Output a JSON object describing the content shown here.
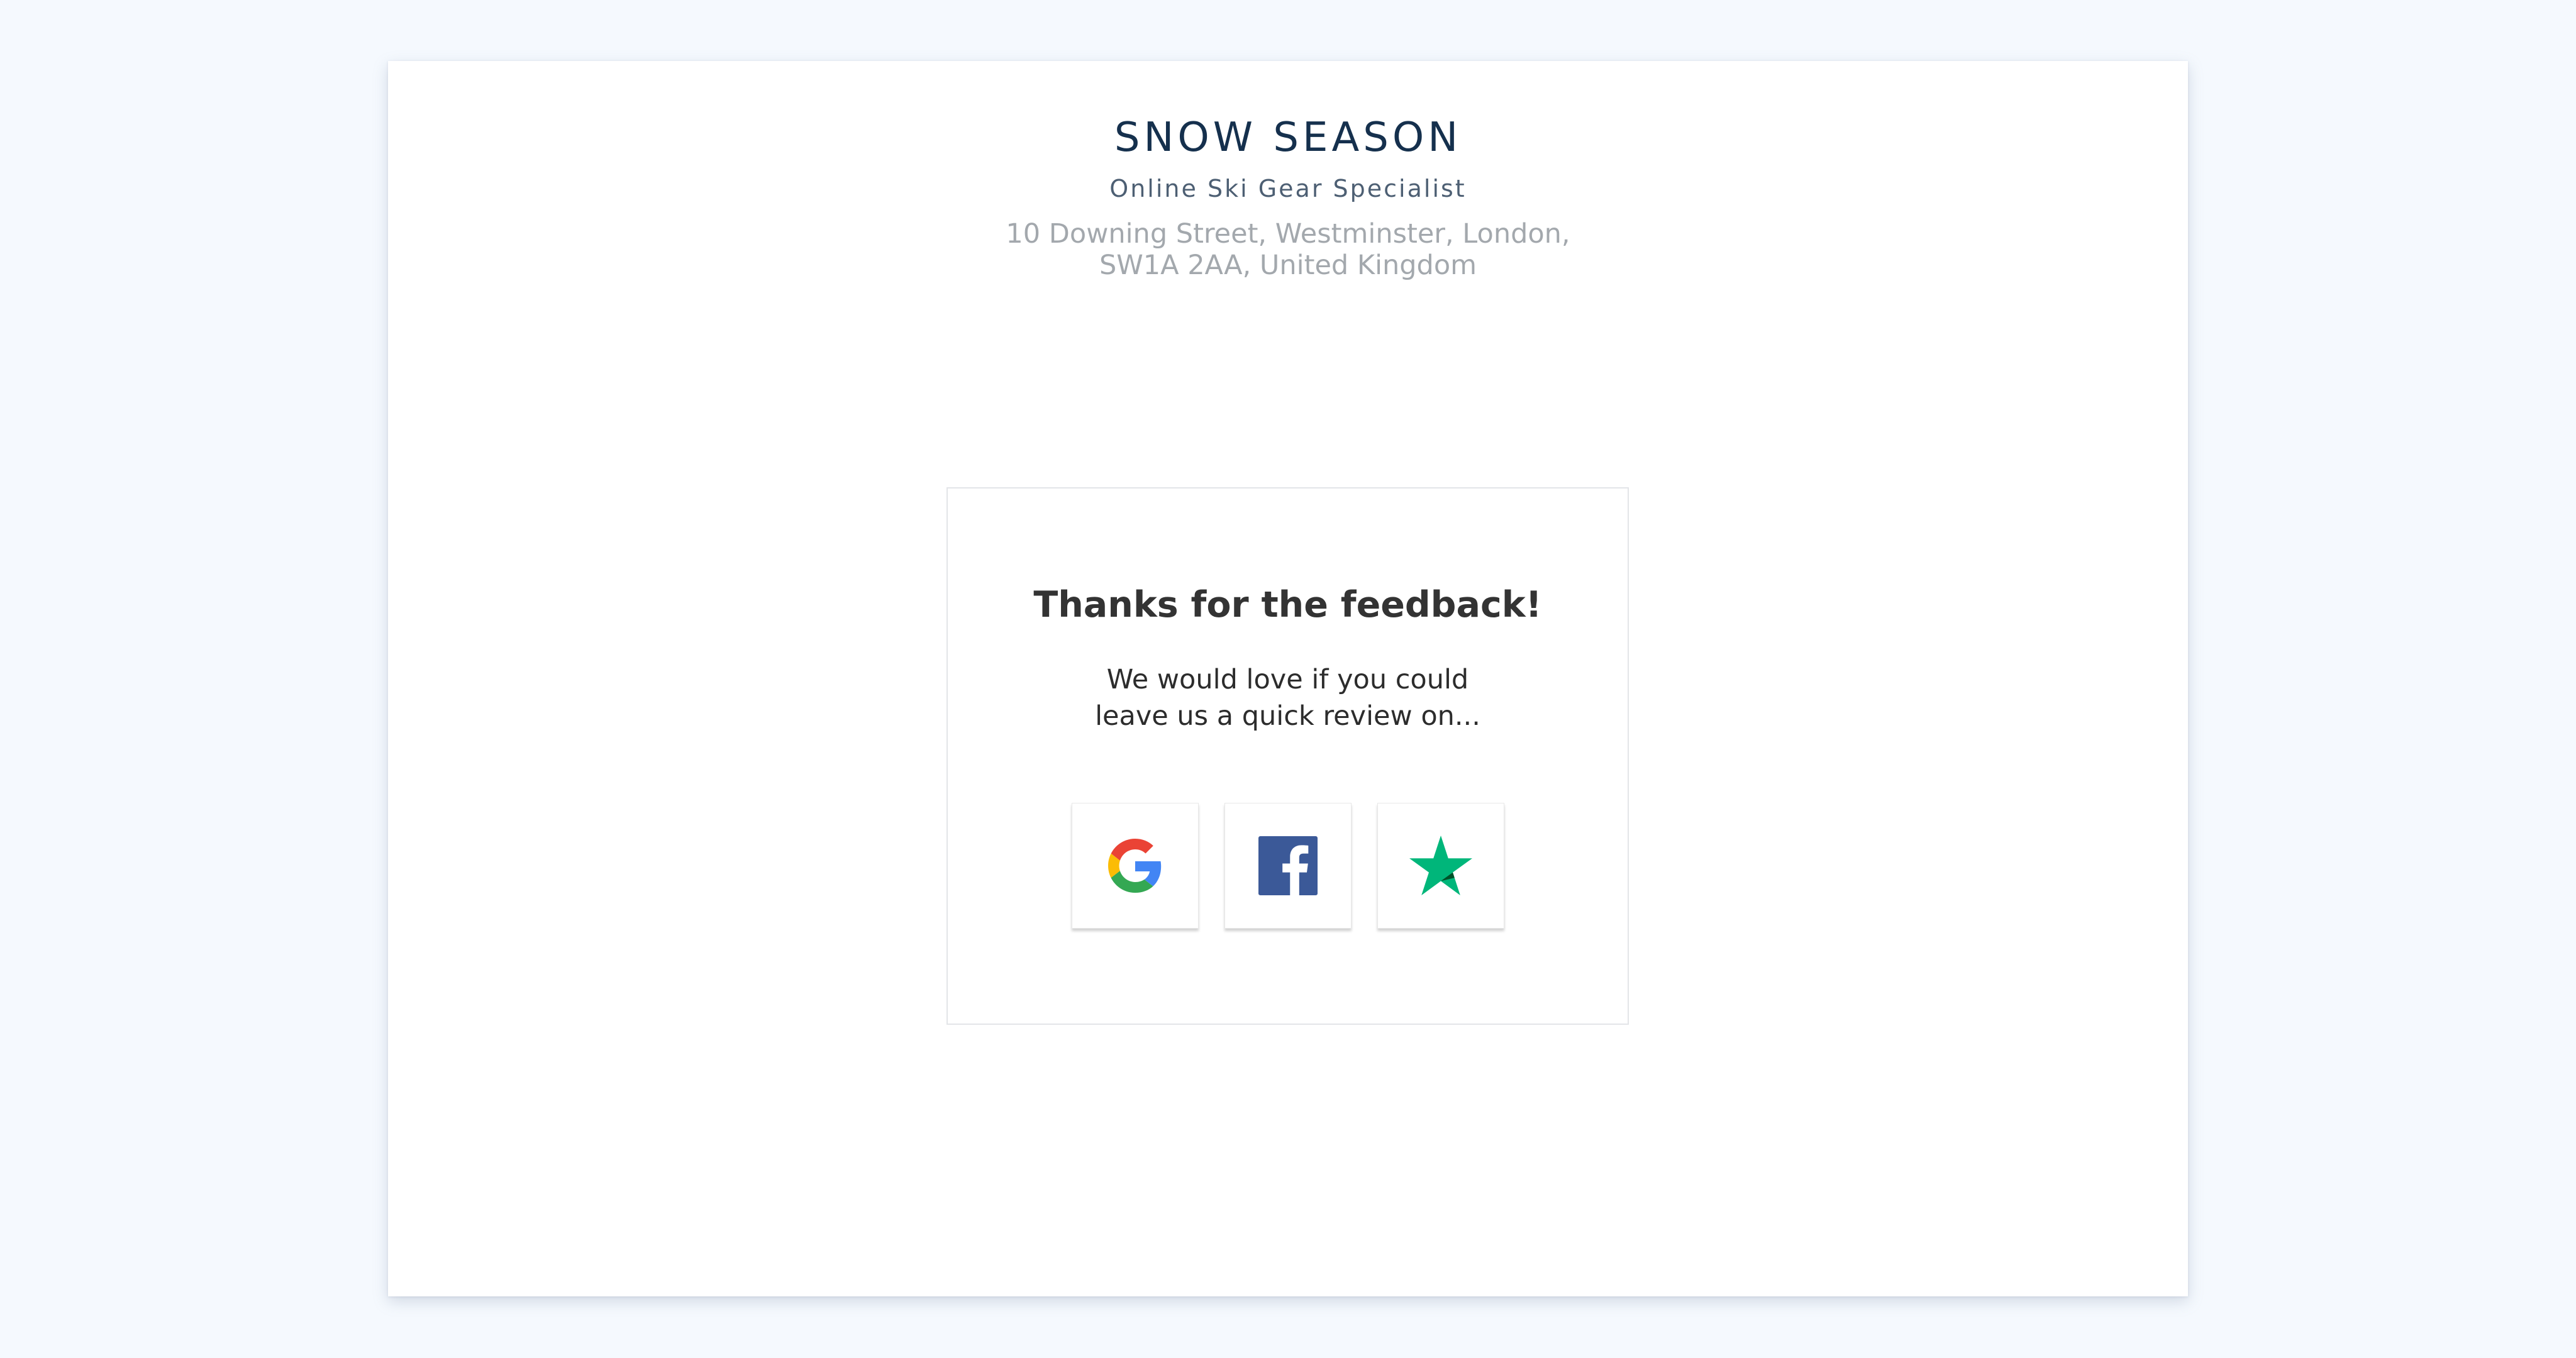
{
  "header": {
    "brand": "SNOW SEASON",
    "tagline": "Online Ski Gear Specialist",
    "address_line1": "10 Downing Street, Westminster, London,",
    "address_line2": "SW1A 2AA, United Kingdom"
  },
  "card": {
    "title": "Thanks for the feedback!",
    "body_line1": "We would love if you could",
    "body_line2": "leave us a quick review on..."
  },
  "review_buttons": [
    {
      "icon": "google-icon",
      "colors": [
        "#4285F4",
        "#EA4335",
        "#FBBC05",
        "#34A853"
      ]
    },
    {
      "icon": "facebook-icon",
      "color": "#3b5998"
    },
    {
      "icon": "trustpilot-star-icon",
      "color": "#00b67a"
    }
  ],
  "colors": {
    "background": "#f5f9fe",
    "brand": "#15304d",
    "tagline": "#4d5f73",
    "address": "#a3a8ad",
    "title": "#333333"
  }
}
